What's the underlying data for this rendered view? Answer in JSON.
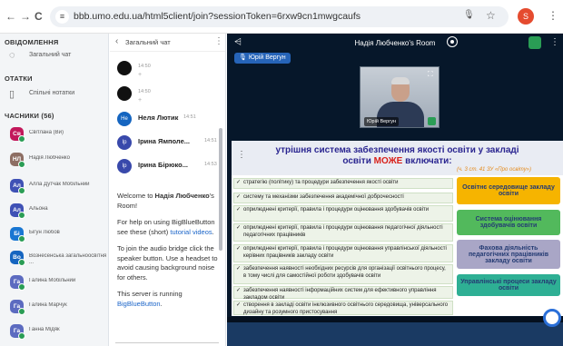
{
  "browser": {
    "url": "bbb.umo.edu.ua/html5client/join?sessionToken=6rxw9cn1mwgcaufs",
    "icons": {
      "back": "←",
      "forward": "→",
      "reload": "C",
      "site": "≡",
      "mic": "🎙",
      "star": "☆",
      "menu": "⋮"
    },
    "profile_initial": "S"
  },
  "sidebar": {
    "messages_title": "ОВІДОМЛЕННЯ",
    "public_chat": "Загальний чат",
    "notes_title": "ОТАТКИ",
    "shared_notes": "Спільні нотатки",
    "users_title": "ЧАСНИКИ (56)",
    "users": [
      {
        "initials": "Св",
        "name": "Світлана (Ви)",
        "color": "#c2185b"
      },
      {
        "initials": "НЛ",
        "name": "Надія Любченко",
        "color": "#8d6e63"
      },
      {
        "initials": "Ал",
        "name": "Алла Дутчак Мобільний",
        "color": "#3f51b5"
      },
      {
        "initials": "Ал",
        "name": "Альона",
        "color": "#3f51b5"
      },
      {
        "initials": "Бі",
        "name": "Бігун Любов",
        "color": "#1976d2"
      },
      {
        "initials": "Во",
        "name": "Вознесенська загальноосвітня ...",
        "color": "#1565c0"
      },
      {
        "initials": "Га",
        "name": "Галина Мобільний",
        "color": "#5c6bc0"
      },
      {
        "initials": "Га",
        "name": "Галина Марчук",
        "color": "#5c6bc0"
      },
      {
        "initials": "Га",
        "name": "Ганна Мідяк",
        "color": "#5c6bc0"
      }
    ]
  },
  "chat": {
    "header": "Загальний чат",
    "messages": [
      {
        "initials": "",
        "name": "",
        "time": "14:50",
        "color": "#111"
      },
      {
        "initials": "",
        "name": "",
        "time": "14:50",
        "color": "#111"
      },
      {
        "initials": "Не",
        "name": "Неля Лютик",
        "time": "14:51",
        "color": "#1565c0"
      },
      {
        "initials": "Ір",
        "name": "Ірина Ямполе...",
        "time": "14:51",
        "color": "#3949ab"
      },
      {
        "initials": "Ір",
        "name": "Ірина Бірюко...",
        "time": "14:53",
        "color": "#3949ab"
      }
    ],
    "welcome_prefix": "Welcome to ",
    "welcome_name": "Надія Любченко",
    "welcome_suffix": "'s Room!",
    "help_prefix": "For help on using BigBlueButton see these (short) ",
    "help_link": "tutorial videos",
    "help_suffix": ".",
    "audio_text": "To join the audio bridge click the speaker button. Use a headset to avoid causing background noise for others.",
    "server_prefix": "This server is running ",
    "server_link": "BigBlueButton",
    "server_suffix": "."
  },
  "presentation": {
    "room_title": "Надія Любченко's Room",
    "presenter": "Юрій Вергун",
    "webcam_name": "Юрій Вергун",
    "slide": {
      "title_line1": "утрішня система забезпечення якості освіти у закладі",
      "title_line2_pre": "освіти ",
      "title_line2_red": "МОЖЕ",
      "title_line2_post": " включати:",
      "reference": "(ч. 3 ст. 41 ЗУ «Про освіту»)",
      "criteria": [
        "стратегію (політику) та процедури забезпечення якості освіти",
        "систему та механізми забезпечення академічної доброчесності",
        "оприлюднені критерії, правила і процедури оцінювання здобувачів освіти",
        "оприлюднені критерії, правила і процедури оцінювання педагогічної діяльності педагогічних працівників",
        "оприлюднені критерії, правила і процедури оцінювання управлінської діяльності керівних працівників закладу освіти",
        "забезпечення наявності необхідних ресурсів для організації освітнього процесу, в тому числі для самостійної роботи здобувачів освіти",
        "забезпечення наявності інформаційних систем для ефективного управління закладом освіти",
        "створення в закладі освіти інклюзивного освітнього середовища, універсального дизайну та розумного пристосування"
      ],
      "categories": [
        {
          "label": "Освітнє середовище закладу освіти",
          "color": "#f6b400"
        },
        {
          "label": "Система оцінювання здобувачів освіти",
          "color": "#52b95c"
        },
        {
          "label": "Фахова діяльність педагогічних працівників закладу освіти",
          "color": "#a9a6c6"
        },
        {
          "label": "Управлінські процеси закладу освіти",
          "color": "#2eaf94"
        }
      ]
    }
  }
}
